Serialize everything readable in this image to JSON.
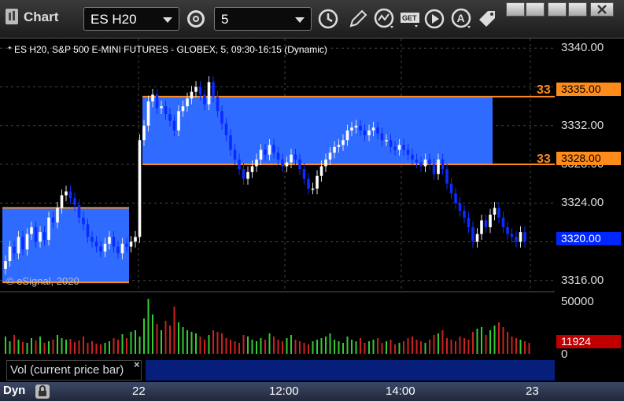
{
  "toolbar": {
    "title": "Chart",
    "symbol": "ES H20",
    "interval": "5"
  },
  "chart": {
    "info_line": "* ES H20, S&P 500 E-MINI FUTURES - GLOBEX, 5, 09:30-16:15 (Dynamic)",
    "watermark": "© eSignal, 2020",
    "price_ticks": [
      "3340.00",
      "3336.00",
      "3332.00",
      "3328.00",
      "3324.00",
      "3320.00",
      "3316.00"
    ],
    "tags": {
      "upper": "3335.00",
      "lower": "3328.00",
      "last": "3320.00",
      "upper_side": "33",
      "lower_side": "33"
    },
    "colors": {
      "zone": "#2f6bff",
      "line": "#ff8c1a",
      "up": "#ffffff",
      "down": "#0b2bff"
    }
  },
  "chart_data": {
    "type": "candlestick",
    "ylim": [
      3315,
      3341
    ],
    "zones": [
      {
        "x_start": 0,
        "x_end": 28,
        "top": 3323.5,
        "bottom": 3315.8
      },
      {
        "x_start": 32,
        "x_end": 112,
        "top": 3335.0,
        "bottom": 3328.0
      }
    ],
    "closes": [
      3318,
      3319.5,
      3318.8,
      3320.5,
      3319.2,
      3320.8,
      3321.5,
      3320,
      3321,
      3320.2,
      3322.5,
      3322,
      3323.5,
      3324.8,
      3325.2,
      3324.5,
      3323.8,
      3322.5,
      3321.8,
      3320.5,
      3320,
      3319.5,
      3319,
      3319.8,
      3320.5,
      3319.5,
      3318.8,
      3319.8,
      3319.5,
      3320,
      3320.5,
      3330.5,
      3332,
      3334.5,
      3335.2,
      3333.8,
      3334,
      3333.2,
      3332.5,
      3331.5,
      3333.5,
      3334,
      3334.8,
      3335.5,
      3336,
      3335.2,
      3334.2,
      3336.5,
      3335,
      3333.5,
      3332.2,
      3331,
      3329.5,
      3328.5,
      3327.5,
      3326.5,
      3327.2,
      3327.8,
      3328.5,
      3329.5,
      3329,
      3330,
      3329.2,
      3328.5,
      3327.8,
      3328.2,
      3329,
      3328.5,
      3327.5,
      3326.5,
      3325.5,
      3325.5,
      3326.8,
      3327.8,
      3328.5,
      3329.2,
      3329.8,
      3330,
      3330.5,
      3331.5,
      3331.8,
      3332,
      3331.5,
      3331,
      3331.5,
      3331.8,
      3331.2,
      3330.5,
      3330.5,
      3329.8,
      3329.5,
      3330,
      3329.5,
      3329,
      3328.5,
      3328.2,
      3327.8,
      3328.5,
      3328,
      3327,
      3328.5,
      3327.5,
      3326,
      3325,
      3324,
      3323.2,
      3322.5,
      3321.5,
      3320,
      3320.8,
      3322.2,
      3321.5,
      3322.8,
      3323.5,
      3322.5,
      3321.5,
      3320.8,
      3320.5,
      3320,
      3321,
      3320
    ],
    "volume": [
      22,
      16,
      24,
      18,
      15,
      14,
      20,
      17,
      22,
      14,
      16,
      18,
      24,
      20,
      18,
      19,
      15,
      17,
      22,
      14,
      16,
      13,
      12,
      14,
      16,
      20,
      18,
      25,
      20,
      28,
      30,
      22,
      45,
      70,
      50,
      38,
      30,
      42,
      36,
      60,
      40,
      34,
      30,
      28,
      26,
      22,
      18,
      24,
      30,
      28,
      26,
      20,
      18,
      16,
      14,
      24,
      22,
      18,
      16,
      20,
      18,
      26,
      22,
      18,
      16,
      20,
      24,
      18,
      16,
      14,
      12,
      16,
      18,
      20,
      22,
      26,
      18,
      16,
      14,
      22,
      18,
      16,
      20,
      14,
      16,
      18,
      20,
      14,
      16,
      18,
      12,
      14,
      16,
      20,
      22,
      18,
      16,
      14,
      18,
      24,
      26,
      30,
      20,
      18,
      16,
      22,
      20,
      18,
      28,
      32,
      34,
      24,
      30,
      36,
      40,
      34,
      28,
      22,
      20,
      18,
      16,
      14
    ],
    "volume_ticks": [
      "50000",
      "0"
    ],
    "volume_last": "11924",
    "x_ticks": [
      "22",
      "12:00",
      "14:00",
      "23"
    ]
  },
  "volume_panel": {
    "label": "Vol (current price bar)"
  },
  "status": {
    "mode": "Dyn"
  }
}
